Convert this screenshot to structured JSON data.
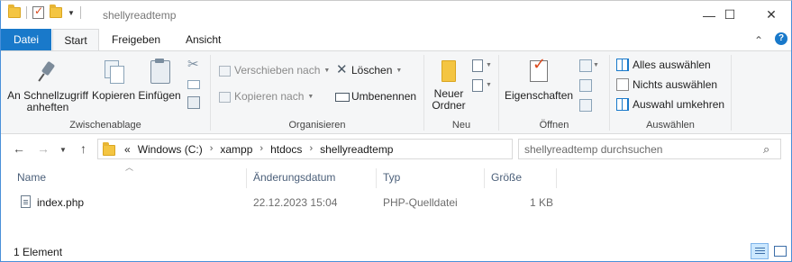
{
  "window": {
    "title": "shellyreadtemp",
    "controls": {
      "minimize": "—",
      "maximize": "☐",
      "close": "✕"
    }
  },
  "ribbon_tabs": [
    "Datei",
    "Start",
    "Freigeben",
    "Ansicht"
  ],
  "ribbon": {
    "zwischenablage": {
      "label": "Zwischenablage",
      "pin_label_line1": "An Schnellzugriff",
      "pin_label_line2": "anheften",
      "copy_label": "Kopieren",
      "paste_label": "Einfügen"
    },
    "organisieren": {
      "label": "Organisieren",
      "move_label": "Verschieben nach",
      "copy_to_label": "Kopieren nach",
      "delete_label": "Löschen",
      "rename_label": "Umbenennen"
    },
    "neu": {
      "label": "Neu",
      "new_folder_line1": "Neuer",
      "new_folder_line2": "Ordner"
    },
    "oeffnen": {
      "label": "Öffnen",
      "properties_label": "Eigenschaften"
    },
    "auswaehlen": {
      "label": "Auswählen",
      "select_all": "Alles auswählen",
      "select_none": "Nichts auswählen",
      "invert": "Auswahl umkehren"
    }
  },
  "address": {
    "overflow": "«",
    "crumbs": [
      "Windows (C:)",
      "xampp",
      "htdocs",
      "shellyreadtemp"
    ]
  },
  "search": {
    "placeholder": "shellyreadtemp durchsuchen"
  },
  "columns": [
    "Name",
    "Änderungsdatum",
    "Typ",
    "Größe"
  ],
  "files": [
    {
      "name": "index.php",
      "modified": "22.12.2023 15:04",
      "type": "PHP-Quelldatei",
      "size": "1 KB",
      "icon": "php-file-icon"
    }
  ],
  "status": {
    "count_text": "1 Element"
  },
  "colors": {
    "accent": "#1979ca",
    "ribbon_bg": "#f5f6f7",
    "header_text": "#4c607a"
  }
}
